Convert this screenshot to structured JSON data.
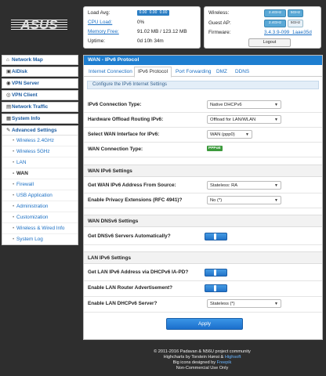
{
  "logo_text": "ASUS",
  "status_left": {
    "load_avg_label": "Load Avg:",
    "load_avg": [
      "0.00",
      "0.00",
      "0.00"
    ],
    "cpu_label": "CPU Load:",
    "cpu_value": "0%",
    "mem_label": "Memory Free:",
    "mem_value": "91.02 MB / 123.12 MB",
    "uptime_label": "Uptime:",
    "uptime_value": "0d 10h 34m"
  },
  "status_right": {
    "wireless_label": "Wireless:",
    "guest_label": "Guest AP:",
    "firmware_label": "Firmware:",
    "band_24": "2.4GHz",
    "band_5": "5GHz",
    "firmware_value": "3.4.3.9-099_1aae35d",
    "logout_label": "Logout"
  },
  "sidebar": {
    "items": [
      {
        "label": "Network Map",
        "icon": "home-icon"
      },
      {
        "label": "AiDisk",
        "icon": "disk-icon"
      },
      {
        "label": "VPN Server",
        "icon": "vpn-server-icon"
      },
      {
        "label": "VPN Client",
        "icon": "vpn-client-icon"
      },
      {
        "label": "Network Traffic",
        "icon": "traffic-icon"
      },
      {
        "label": "System Info",
        "icon": "info-icon"
      }
    ],
    "advanced_label": "Advanced Settings",
    "sub": [
      "Wireless 2.4GHz",
      "Wireless 5GHz",
      "LAN",
      "WAN",
      "Firewall",
      "USB Application",
      "Administration",
      "Customization",
      "Wireless & Wired Info",
      "System Log"
    ],
    "active_sub": "WAN"
  },
  "main": {
    "title": "WAN - IPv6 Protocol",
    "tabs": [
      "Internet Connection",
      "IPv6 Protocol",
      "Port Forwarding",
      "DMZ",
      "DDNS"
    ],
    "active_tab": "IPv6 Protocol",
    "info": "Configure the IPv6 Internet Settings",
    "conn_type_label": "IPv6 Connection Type:",
    "conn_type_value": "Native DHCPv6",
    "offload_label": "Hardware Offload Routing IPv6:",
    "offload_value": "Offload for LAN/WLAN",
    "wan_iface_label": "Select WAN Interface for IPv6:",
    "wan_iface_value": "WAN (ppp0)",
    "wan_conn_type_label": "WAN Connection Type:",
    "wan_conn_type_value": "PPPoE",
    "sec_wan_ipv6": "WAN IPv6 Settings",
    "get_addr_label": "Get WAN IPv6 Address From Source:",
    "get_addr_value": "Stateless: RA",
    "privacy_label": "Enable Privacy Extensions (RFC 4941)?",
    "privacy_value": "No (*)",
    "sec_wan_dns": "WAN DNSv6 Settings",
    "dns_auto_label": "Get DNSv6 Servers Automatically?",
    "dns_auto_on": true,
    "sec_lan_ipv6": "LAN IPv6 Settings",
    "lan_dhcp_pd_label": "Get LAN IPv6 Address via DHCPv6 IA-PD?",
    "lan_dhcp_pd_on": true,
    "lan_ra_label": "Enable LAN Router Advertisement?",
    "lan_ra_on": true,
    "lan_dhcpv6_label": "Enable LAN DHCPv6 Server?",
    "lan_dhcpv6_value": "Stateless (*)",
    "apply_label": "Apply"
  },
  "footer": {
    "line1": "© 2011-2016 Padavan & N56U project community",
    "line2_prefix": "Highcharts by Torstein Hønsi &",
    "line2_link": "Highsoft",
    "line3_prefix": "Big icons designed by",
    "line3_link": "Freepik",
    "line4": "Non-Commercial Use Only"
  },
  "colors": {
    "accent": "#1e7ed0",
    "background": "#2e2e2e",
    "ppp_badge": "#3c9a3c"
  }
}
